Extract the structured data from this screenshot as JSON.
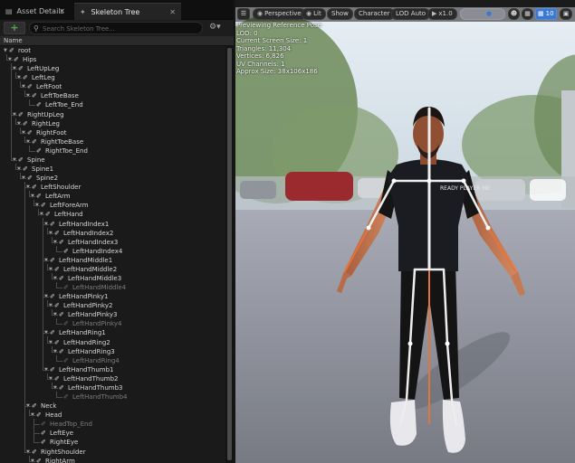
{
  "tabs": [
    {
      "label": "Asset Details",
      "icon": "asset-details-icon",
      "closable": true
    },
    {
      "label": "Skeleton Tree",
      "icon": "skeleton-tree-icon",
      "closable": true,
      "active": true
    }
  ],
  "toolbar": {
    "add_label": "+",
    "search_placeholder": "Search Skeleton Tree..."
  },
  "column_header": "Name",
  "tree": [
    {
      "name": "root",
      "depth": 0,
      "expanded": true
    },
    {
      "name": "Hips",
      "depth": 1,
      "expanded": true
    },
    {
      "name": "LeftUpLeg",
      "depth": 2,
      "expanded": true
    },
    {
      "name": "LeftLeg",
      "depth": 3,
      "expanded": true
    },
    {
      "name": "LeftFoot",
      "depth": 4,
      "expanded": true
    },
    {
      "name": "LeftToeBase",
      "depth": 5,
      "expanded": true
    },
    {
      "name": "LeftToe_End",
      "depth": 6
    },
    {
      "name": "RightUpLeg",
      "depth": 2,
      "expanded": true
    },
    {
      "name": "RightLeg",
      "depth": 3,
      "expanded": true
    },
    {
      "name": "RightFoot",
      "depth": 4,
      "expanded": true
    },
    {
      "name": "RightToeBase",
      "depth": 5,
      "expanded": true
    },
    {
      "name": "RightToe_End",
      "depth": 6
    },
    {
      "name": "Spine",
      "depth": 2,
      "expanded": true
    },
    {
      "name": "Spine1",
      "depth": 3,
      "expanded": true
    },
    {
      "name": "Spine2",
      "depth": 4,
      "expanded": true
    },
    {
      "name": "LeftShoulder",
      "depth": 5,
      "expanded": true
    },
    {
      "name": "LeftArm",
      "depth": 6,
      "expanded": true
    },
    {
      "name": "LeftForeArm",
      "depth": 7,
      "expanded": true
    },
    {
      "name": "LeftHand",
      "depth": 8,
      "expanded": true
    },
    {
      "name": "LeftHandIndex1",
      "depth": 9,
      "expanded": true
    },
    {
      "name": "LeftHandIndex2",
      "depth": 10,
      "expanded": true
    },
    {
      "name": "LeftHandIndex3",
      "depth": 11,
      "expanded": true
    },
    {
      "name": "LeftHandIndex4",
      "depth": 12
    },
    {
      "name": "LeftHandMiddle1",
      "depth": 9,
      "expanded": true
    },
    {
      "name": "LeftHandMiddle2",
      "depth": 10,
      "expanded": true
    },
    {
      "name": "LeftHandMiddle3",
      "depth": 11,
      "expanded": true
    },
    {
      "name": "LeftHandMiddle4",
      "depth": 12,
      "dim": true
    },
    {
      "name": "LeftHandPinky1",
      "depth": 9,
      "expanded": true
    },
    {
      "name": "LeftHandPinky2",
      "depth": 10,
      "expanded": true
    },
    {
      "name": "LeftHandPinky3",
      "depth": 11,
      "expanded": true
    },
    {
      "name": "LeftHandPinky4",
      "depth": 12,
      "dim": true
    },
    {
      "name": "LeftHandRing1",
      "depth": 9,
      "expanded": true
    },
    {
      "name": "LeftHandRing2",
      "depth": 10,
      "expanded": true
    },
    {
      "name": "LeftHandRing3",
      "depth": 11,
      "expanded": true
    },
    {
      "name": "LeftHandRing4",
      "depth": 12,
      "dim": true
    },
    {
      "name": "LeftHandThumb1",
      "depth": 9,
      "expanded": true
    },
    {
      "name": "LeftHandThumb2",
      "depth": 10,
      "expanded": true
    },
    {
      "name": "LeftHandThumb3",
      "depth": 11,
      "expanded": true
    },
    {
      "name": "LeftHandThumb4",
      "depth": 12,
      "dim": true
    },
    {
      "name": "Neck",
      "depth": 5,
      "expanded": true
    },
    {
      "name": "Head",
      "depth": 6,
      "expanded": true
    },
    {
      "name": "HeadTop_End",
      "depth": 7,
      "dim": true
    },
    {
      "name": "LeftEye",
      "depth": 7
    },
    {
      "name": "RightEye",
      "depth": 7
    },
    {
      "name": "RightShoulder",
      "depth": 5,
      "expanded": true
    },
    {
      "name": "RightArm",
      "depth": 6,
      "expanded": true
    }
  ],
  "viewport": {
    "menu_icon": "hamburger-icon",
    "buttons": [
      {
        "name": "perspective",
        "label": "Perspective",
        "icon": "camera-icon"
      },
      {
        "name": "lit",
        "label": "Lit",
        "icon": "lit-sphere-icon"
      },
      {
        "name": "show",
        "label": "Show",
        "icon": ""
      },
      {
        "name": "character",
        "label": "Character",
        "icon": ""
      },
      {
        "name": "lod",
        "label": "LOD Auto",
        "icon": ""
      },
      {
        "name": "speed",
        "label": "x1.0",
        "icon": "play-icon"
      }
    ],
    "toggle_icons": [
      "person-icon",
      "grid-icon"
    ],
    "grid_value": "10",
    "layout_icon": "layout-icon",
    "stats": [
      "Previewing Reference Pose",
      "LOD: 0",
      "Current Screen Size: 1",
      "Triangles: 11,304",
      "Vertices: 6,826",
      "UV Channels: 1",
      "Approx Size: 38x106x186"
    ],
    "shirt_text": "READY PLAYER ME"
  },
  "colors": {
    "accent": "#3a78d2",
    "add_green": "#4caf50",
    "bone_white": "#eeeeee",
    "bone_orange": "#e8733a"
  }
}
